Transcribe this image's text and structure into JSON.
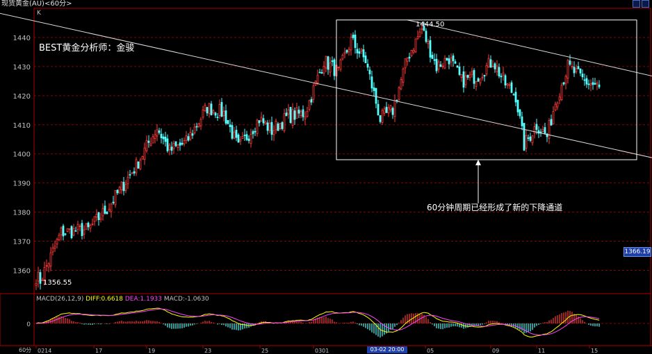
{
  "window": {
    "title": "现货黄金(AU)<60分>",
    "k_marker": "K",
    "timeframe": "60分"
  },
  "annotations": {
    "analyst": "BEST黄金分析师：金骏",
    "channel_note": "60分钟周期已经形成了新的下降通道",
    "peak_value": "1444.50",
    "low_value": "1356.55",
    "last_price": "1366.19",
    "crosshair_date": "03-02 20:00"
  },
  "macd": {
    "params": "MACD(26,12,9)",
    "diff_label": "DIFF:0.6618",
    "dea_label": "DEA:1.1933",
    "macd_label": "MACD:-1.0630",
    "zero_label": "0"
  },
  "colors": {
    "background": "#000000",
    "grid": "#8b0000",
    "up_candle": "#ff3c3c",
    "down_candle": "#54ffff",
    "trendline": "#dcdcdc",
    "diff_line": "#ffff00",
    "dea_line": "#ff44ff"
  },
  "chart_data": {
    "type": "candlestick",
    "ylim": [
      1352,
      1450
    ],
    "yticks": [
      1360,
      1370,
      1380,
      1390,
      1400,
      1410,
      1420,
      1430,
      1440
    ],
    "xtick_labels": [
      "0214",
      "17",
      "19",
      "23",
      "25",
      "0301",
      "05",
      "09",
      "11",
      "15"
    ],
    "anchors": [
      {
        "bar": 0,
        "close": 1358
      },
      {
        "bar": 2,
        "close": 1356.55
      },
      {
        "bar": 12,
        "close": 1373
      },
      {
        "bar": 25,
        "close": 1374
      },
      {
        "bar": 35,
        "close": 1382
      },
      {
        "bar": 48,
        "close": 1396
      },
      {
        "bar": 58,
        "close": 1409
      },
      {
        "bar": 64,
        "close": 1401
      },
      {
        "bar": 72,
        "close": 1404
      },
      {
        "bar": 82,
        "close": 1416
      },
      {
        "bar": 90,
        "close": 1414
      },
      {
        "bar": 97,
        "close": 1402
      },
      {
        "bar": 107,
        "close": 1412
      },
      {
        "bar": 113,
        "close": 1408
      },
      {
        "bar": 121,
        "close": 1413
      },
      {
        "bar": 129,
        "close": 1414
      },
      {
        "bar": 133,
        "close": 1422
      },
      {
        "bar": 138,
        "close": 1432
      },
      {
        "bar": 145,
        "close": 1428
      },
      {
        "bar": 151,
        "close": 1439
      },
      {
        "bar": 158,
        "close": 1432
      },
      {
        "bar": 165,
        "close": 1412
      },
      {
        "bar": 171,
        "close": 1415
      },
      {
        "bar": 178,
        "close": 1433
      },
      {
        "bar": 185,
        "close": 1443
      },
      {
        "bar": 192,
        "close": 1430
      },
      {
        "bar": 198,
        "close": 1433
      },
      {
        "bar": 204,
        "close": 1425
      },
      {
        "bar": 212,
        "close": 1427
      },
      {
        "bar": 219,
        "close": 1432
      },
      {
        "bar": 225,
        "close": 1424
      },
      {
        "bar": 230,
        "close": 1420
      },
      {
        "bar": 234,
        "close": 1403
      },
      {
        "bar": 240,
        "close": 1410
      },
      {
        "bar": 245,
        "close": 1406
      },
      {
        "bar": 249,
        "close": 1418
      },
      {
        "bar": 255,
        "close": 1430
      },
      {
        "bar": 263,
        "close": 1425
      },
      {
        "bar": 270,
        "close": 1423
      }
    ],
    "channel_lines": [
      {
        "name": "upper",
        "from": {
          "bar": -22,
          "price": 1449
        },
        "to": {
          "bar": 306,
          "price": 1397
        }
      },
      {
        "name": "lower",
        "from": {
          "bar": 178,
          "price": 1446
        },
        "to": {
          "bar": 306,
          "price": 1425
        }
      }
    ],
    "highlight_box": {
      "bar_from": 144,
      "bar_to": 288,
      "price_low": 1398,
      "price_high": 1446
    },
    "arrow": {
      "bar": 212,
      "price_from": 1383,
      "price_to": 1398
    }
  }
}
